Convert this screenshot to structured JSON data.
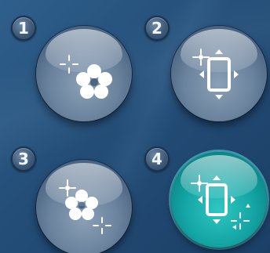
{
  "buttons": [
    {
      "number": "1",
      "icon": "target-to-flower-icon",
      "active": false
    },
    {
      "number": "2",
      "icon": "frame-with-handles-icon",
      "active": false
    },
    {
      "number": "3",
      "icon": "flower-to-target-icon",
      "active": false
    },
    {
      "number": "4",
      "icon": "frame-with-handles-target-icon",
      "active": true
    }
  ],
  "colors": {
    "background": "#234d77",
    "button_inactive": "#6b839d",
    "button_active": "#15a6a6",
    "icon": "#ffffff"
  }
}
